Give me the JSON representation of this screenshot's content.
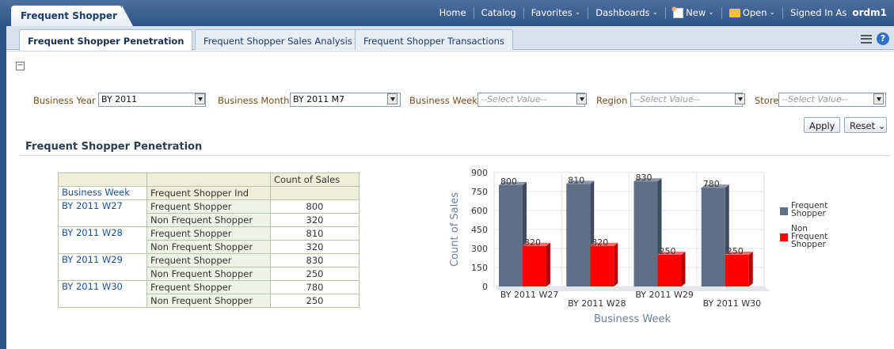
{
  "app": {
    "dashboard_tab": "Frequent Shopper",
    "nav": {
      "home": "Home",
      "catalog": "Catalog",
      "favorites": "Favorites",
      "dashboards": "Dashboards",
      "new": "New",
      "open": "Open",
      "signed_in_as": "Signed In As",
      "user": "ordm1"
    }
  },
  "tabs": [
    {
      "label": "Frequent Shopper Penetration",
      "active": true
    },
    {
      "label": "Frequent Shopper Sales Analysis",
      "active": false
    },
    {
      "label": "Frequent Shopper Transactions",
      "active": false
    }
  ],
  "prompts": {
    "business_year": {
      "label": "Business Year",
      "value": "BY 2011"
    },
    "business_month": {
      "label": "Business Month",
      "value": "BY 2011 M7"
    },
    "business_week": {
      "label": "Business Week",
      "value": "--Select Value--"
    },
    "region": {
      "label": "Region",
      "value": "--Select Value--"
    },
    "store": {
      "label": "Store",
      "value": "--Select Value--"
    },
    "apply": "Apply",
    "reset": "Reset"
  },
  "section_title": "Frequent Shopper Penetration",
  "table": {
    "measure_header": "Count of Sales",
    "col_week": "Business Week",
    "col_ind": "Frequent Shopper Ind",
    "rows": [
      {
        "week": "BY 2011 W27",
        "ind": "Frequent Shopper",
        "value": "800"
      },
      {
        "week": "",
        "ind": "Non Frequent Shopper",
        "value": "320"
      },
      {
        "week": "BY 2011 W28",
        "ind": "Frequent Shopper",
        "value": "810"
      },
      {
        "week": "",
        "ind": "Non Frequent Shopper",
        "value": "320"
      },
      {
        "week": "BY 2011 W29",
        "ind": "Frequent Shopper",
        "value": "830"
      },
      {
        "week": "",
        "ind": "Non Frequent Shopper",
        "value": "250"
      },
      {
        "week": "BY 2011 W30",
        "ind": "Frequent Shopper",
        "value": "780"
      },
      {
        "week": "",
        "ind": "Non Frequent Shopper",
        "value": "250"
      }
    ]
  },
  "colors": {
    "frequent": "#5f6f86",
    "non_frequent": "#ff0000",
    "accent": "#2e5587"
  },
  "chart_data": {
    "type": "bar",
    "categories": [
      "BY 2011 W27",
      "BY 2011 W28",
      "BY 2011 W29",
      "BY 2011 W30"
    ],
    "series": [
      {
        "name": "Frequent Shopper",
        "values": [
          800,
          810,
          830,
          780
        ]
      },
      {
        "name": "Non Frequent Shopper",
        "values": [
          320,
          320,
          250,
          250
        ]
      }
    ],
    "xlabel": "Business Week",
    "ylabel": "Count of Sales",
    "ylim": [
      0,
      900
    ],
    "yticks": [
      0,
      150,
      300,
      450,
      600,
      750,
      900
    ],
    "legend": "right",
    "legend_labels": [
      [
        "Frequent",
        "Shopper"
      ],
      [
        "Non",
        "Frequent",
        "Shopper"
      ]
    ],
    "grid": true
  }
}
